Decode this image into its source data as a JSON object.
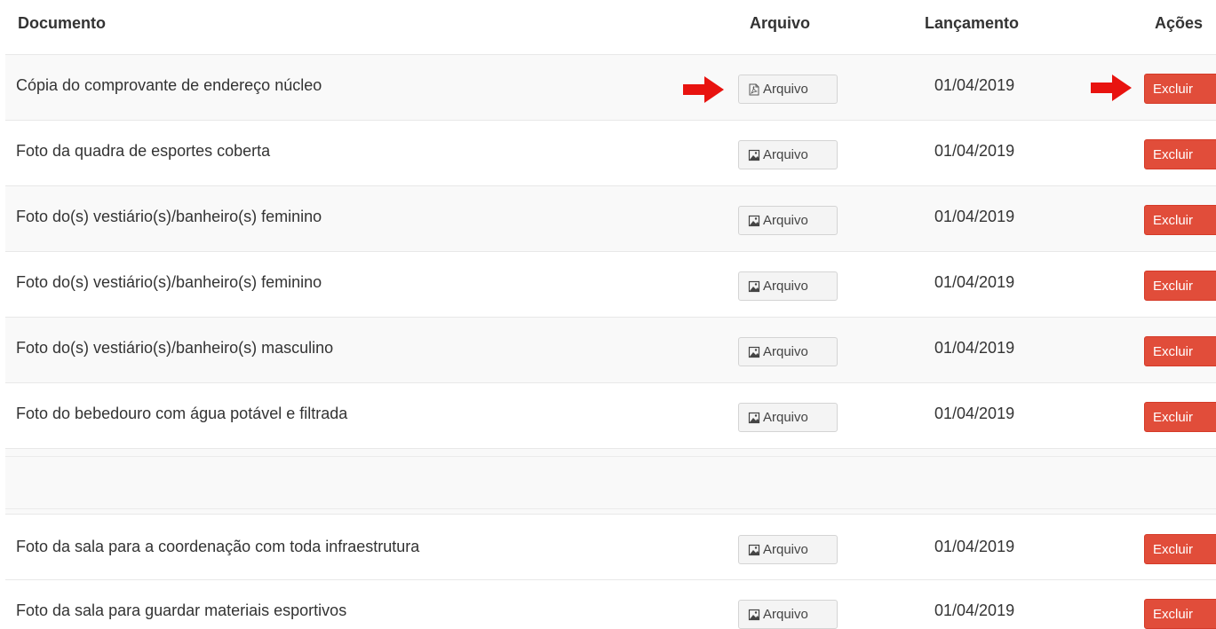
{
  "header": {
    "col_document": "Documento",
    "col_file": "Arquivo",
    "col_date": "Lançamento",
    "col_actions": "Ações"
  },
  "rows": [
    {
      "document": "Cópia do comprovante de endereço núcleo",
      "file_label": "Arquivo",
      "file_icon": "pdf-file-icon",
      "date": "01/04/2019",
      "action_label": "Excluir"
    },
    {
      "document": "Foto da quadra de esportes coberta",
      "file_label": "Arquivo",
      "file_icon": "image-file-icon",
      "date": "01/04/2019",
      "action_label": "Excluir"
    },
    {
      "document": "Foto do(s) vestiário(s)/banheiro(s) feminino",
      "file_label": "Arquivo",
      "file_icon": "image-file-icon",
      "date": "01/04/2019",
      "action_label": "Excluir"
    },
    {
      "document": "Foto do(s) vestiário(s)/banheiro(s) feminino",
      "file_label": "Arquivo",
      "file_icon": "image-file-icon",
      "date": "01/04/2019",
      "action_label": "Excluir"
    },
    {
      "document": "Foto do(s) vestiário(s)/banheiro(s) masculino",
      "file_label": "Arquivo",
      "file_icon": "image-file-icon",
      "date": "01/04/2019",
      "action_label": "Excluir"
    },
    {
      "document": "Foto do bebedouro com água potável e filtrada",
      "file_label": "Arquivo",
      "file_icon": "image-file-icon",
      "date": "01/04/2019",
      "action_label": "Excluir"
    },
    {
      "document": "",
      "file_label": "",
      "file_icon": "",
      "date": "",
      "action_label": ""
    },
    {
      "document": "Foto da sala para a coordenação com toda infraestrutura",
      "file_label": "Arquivo",
      "file_icon": "image-file-icon",
      "date": "01/04/2019",
      "action_label": "Excluir"
    },
    {
      "document": "Foto da sala para guardar materiais esportivos",
      "file_label": "Arquivo",
      "file_icon": "image-file-icon",
      "date": "01/04/2019",
      "action_label": "Excluir"
    }
  ],
  "annotations": {
    "arrow_color": "#e8130f"
  },
  "colors": {
    "danger": "#e14d3a",
    "row_stripe": "#f9f9f9"
  }
}
